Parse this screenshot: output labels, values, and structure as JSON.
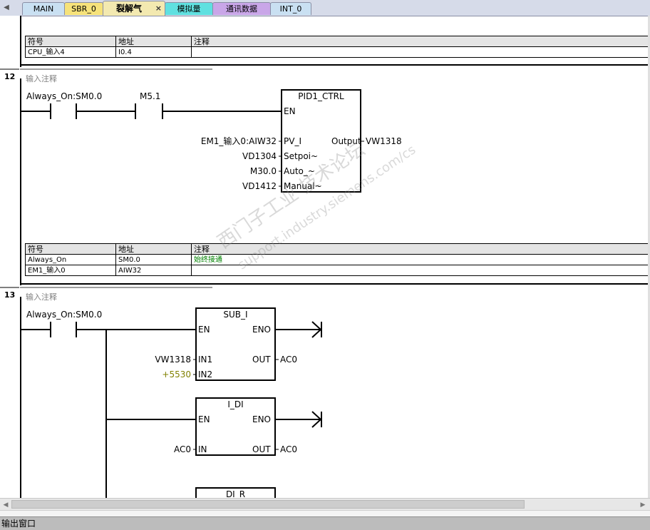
{
  "tabs": [
    {
      "label": "MAIN",
      "color": "#c9e0f2"
    },
    {
      "label": "SBR_0",
      "color": "#f6e27a"
    },
    {
      "label": "裂解气",
      "color": "#f3e9b0",
      "active": true,
      "close": "×"
    },
    {
      "label": "模拟量",
      "color": "#5fe0e0"
    },
    {
      "label": "通讯数据",
      "color": "#c9a6e8"
    },
    {
      "label": "INT_0",
      "color": "#c9e0f2"
    }
  ],
  "table_headers": {
    "symbol": "符号",
    "address": "地址",
    "comment": "注释"
  },
  "top_table": {
    "rows": [
      {
        "symbol": "CPU_输入4",
        "address": "I0.4",
        "comment": ""
      }
    ]
  },
  "network12": {
    "number": "12",
    "comment": "输入注释",
    "contact1_label": "Always_On:SM0.0",
    "contact2_label": "M5.1",
    "box": {
      "title": "PID1_CTRL",
      "en": "EN",
      "inputs": [
        {
          "operand": "EM1_输入0:AIW32",
          "pin": "PV_I"
        },
        {
          "operand": "VD1304",
          "pin": "Setpoi~"
        },
        {
          "operand": "M30.0",
          "pin": "Auto_~"
        },
        {
          "operand": "VD1412",
          "pin": "Manual~"
        }
      ],
      "output_pin": "Output",
      "output_operand": "VW1318"
    },
    "table": [
      {
        "symbol": "Always_On",
        "address": "SM0.0",
        "comment": "始终接通"
      },
      {
        "symbol": "EM1_输入0",
        "address": "AIW32",
        "comment": ""
      }
    ]
  },
  "network13": {
    "number": "13",
    "comment": "输入注释",
    "contact_label": "Always_On:SM0.0",
    "sub_box": {
      "title": "SUB_I",
      "en": "EN",
      "eno": "ENO",
      "in1_pin": "IN1",
      "in1_operand": "VW1318",
      "in2_pin": "IN2",
      "in2_operand": "+5530",
      "out_pin": "OUT",
      "out_operand": "AC0"
    },
    "idi_box": {
      "title": "I_DI",
      "en": "EN",
      "eno": "ENO",
      "in_pin": "IN",
      "in_operand": "AC0",
      "out_pin": "OUT",
      "out_operand": "AC0"
    },
    "dir_box": {
      "title": "DI_R"
    }
  },
  "output_window": "输出窗口",
  "watermark": {
    "line1": "西门子工业  技术论坛",
    "line2": "support.industry.siemens.com/cs"
  }
}
